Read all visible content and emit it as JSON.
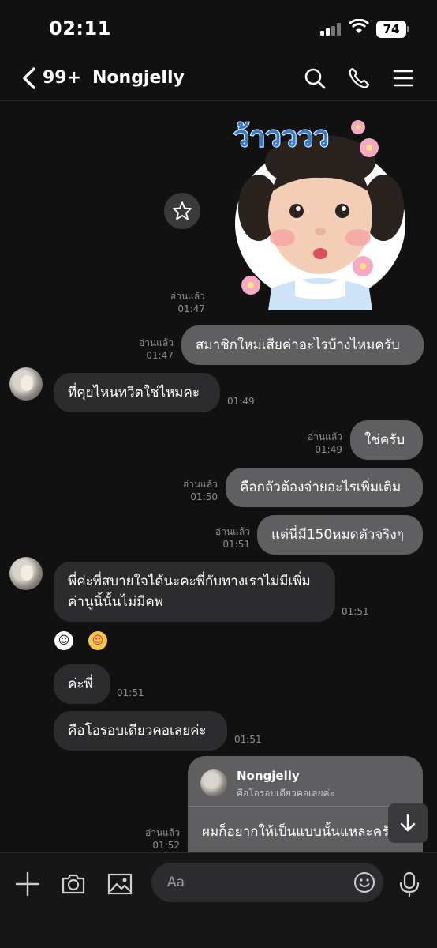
{
  "status_bar": {
    "time": "02:11",
    "battery": "74"
  },
  "header": {
    "unread_count": "99+",
    "contact_name": "Nongjelly"
  },
  "messages": [
    {
      "id": "m0",
      "side": "out",
      "type": "sticker",
      "sticker_text": "ว้าวววว",
      "read_label": "อ่านแล้ว",
      "time": "01:47"
    },
    {
      "id": "m1",
      "side": "out",
      "text": "สมาชิกใหม่เสียค่าอะไรบ้างไหมครับ",
      "read_label": "อ่านแล้ว",
      "time": "01:47"
    },
    {
      "id": "m2",
      "side": "in",
      "text": "ที่คุยไหนทวิตใช่ไหมคะ",
      "time": "01:49"
    },
    {
      "id": "m3",
      "side": "out",
      "text": "ใช่ครับ",
      "read_label": "อ่านแล้ว",
      "time": "01:49"
    },
    {
      "id": "m4",
      "side": "out",
      "text": "คือกลัวต้องจ่ายอะไรเพิ่มเติม",
      "read_label": "อ่านแล้ว",
      "time": "01:50"
    },
    {
      "id": "m5",
      "side": "out",
      "text": "แต่นี่มี150หมดตัวจริงๆ",
      "read_label": "อ่านแล้ว",
      "time": "01:51"
    },
    {
      "id": "m6",
      "side": "in",
      "text_line1": "พี่ค่ะพี่สบายใจได้นะคะพี่กับทางเราไม่มีเพิ่ม",
      "text_line2": "ค่านูนิ้นั้นไม่มีคพ",
      "time": "01:51",
      "reactions": [
        "☺",
        "😍"
      ]
    },
    {
      "id": "m7",
      "side": "in",
      "text": "ค่ะพี่",
      "time": "01:51"
    },
    {
      "id": "m8",
      "side": "in",
      "text": "คือโอรอบเดียวคอเลยค่ะ",
      "time": "01:51"
    },
    {
      "id": "m9",
      "side": "out",
      "type": "reply",
      "reply_to_name": "Nongjelly",
      "reply_to_text": "คือโอรอบเดียวคอเลยค่ะ",
      "text": "ผมก็อยากให้เป็นแบบนั้นแหละครับ",
      "read_label": "อ่านแล้ว",
      "time": "01:52"
    }
  ],
  "input": {
    "placeholder": "Aa"
  },
  "colors": {
    "background": "#111112",
    "bubble_out": "#5f5f61",
    "bubble_in": "#2c2c2e",
    "meta": "#8e8e93"
  },
  "icons": [
    "back-icon",
    "search-icon",
    "phone-icon",
    "menu-icon",
    "star-icon",
    "plus-icon",
    "camera-icon",
    "image-icon",
    "emoji-icon",
    "mic-icon",
    "arrow-down-icon"
  ]
}
